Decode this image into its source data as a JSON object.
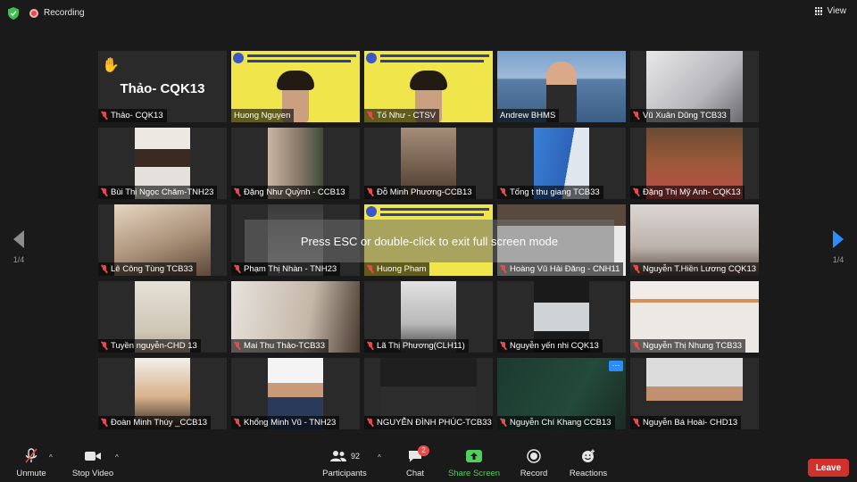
{
  "topbar": {
    "recording_label": "Recording",
    "view_label": "View"
  },
  "nav": {
    "left_count": "1/4",
    "right_count": "1/4"
  },
  "toast": "Press ESC or double-click to exit full screen mode",
  "tiles": [
    "Thảo- CQK13",
    "Huong Nguyen",
    "Tố Như - CTSV",
    "Andrew BHMS",
    "Vũ Xuân Dũng TCB33",
    "Bùi Thị Ngọc Chăm-TNH23",
    "Đặng Như Quỳnh - CCB13",
    "Đỗ Minh Phương-CCB13",
    "Tống t thu giang TCB33",
    "Đặng Thị Mỹ Anh- CQK13",
    "Lê Công Tùng TCB33",
    "Phạm Thị Nhàn - TNH23",
    "Huong Pham",
    "Hoàng Vũ Hải Đăng - CNH11",
    "Nguyễn T.Hiền Lương CQK13",
    "Tuyền nguyễn-CHD 13",
    "Mai Thu Thảo-TCB33",
    "Lã Thị Phương(CLH11)",
    "Nguyễn yến nhi CQK13",
    "Nguyễn Thị Nhung TCB33",
    "Đoàn Minh Thúy _CCB13",
    "Khổng Minh Vũ - TNH23",
    "NGUYỄN ĐÌNH PHÚC-TCB33",
    "Nguyễn Chí Khang CCB13",
    "Nguyễn Bá Hoài- CHD13"
  ],
  "featured_name": "Thảo- CQK13",
  "more_badge": "···",
  "toolbar": {
    "unmute": "Unmute",
    "stop_video": "Stop Video",
    "participants": "Participants",
    "participants_count": "92",
    "chat": "Chat",
    "chat_badge": "2",
    "share_screen": "Share Screen",
    "record": "Record",
    "reactions": "Reactions",
    "leave": "Leave"
  },
  "colors": {
    "accent": "#2d8cff",
    "share": "#4fd05a",
    "leave": "#d0312d",
    "muted": "#e84a4a",
    "active_border": "#a8e63a"
  }
}
